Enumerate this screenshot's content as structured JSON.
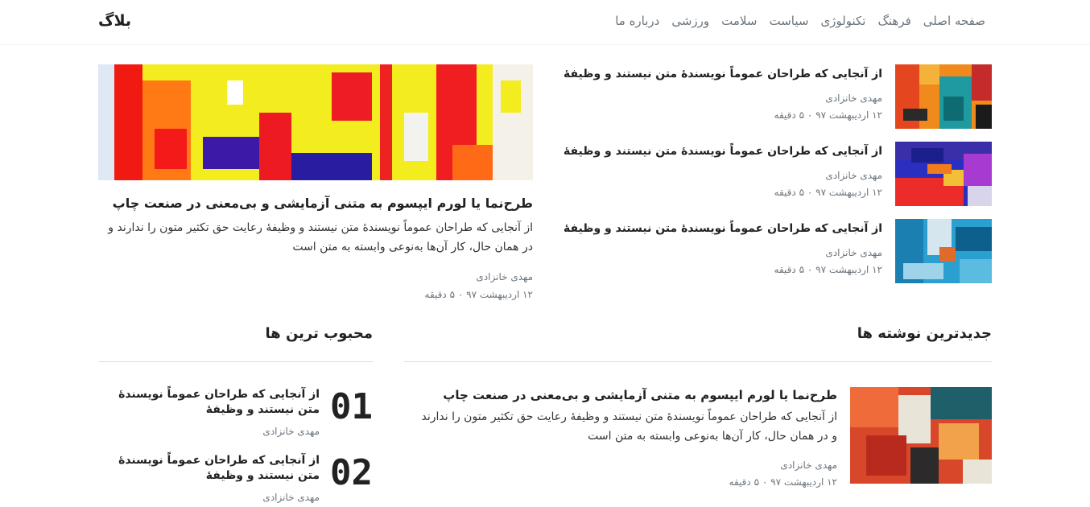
{
  "header": {
    "brand": "بلاگ",
    "nav": [
      "صفحه اصلی",
      "فرهنگ",
      "تکنولوژی",
      "سیاست",
      "سلامت",
      "ورزشی",
      "درباره ما"
    ]
  },
  "featured": {
    "title": "طرح‌نما یا لورم ایپسوم به متنی آزمایشی و بی‌معنی در صنعت چاپ",
    "excerpt": "از آنجایی که طراحان عموماً نویسندهٔ متن نیستند و وظیفهٔ رعایت حق تکثیر متون را ندارند و در همان حال، کار آن‌ها به‌نوعی وابسته به متن است",
    "author": "مهدی خانزادی",
    "meta": "۱۲ اردیبهشت ۹۷ ۰ ۵ دقیقه"
  },
  "side_posts": [
    {
      "title": "از آنجایی که طراحان عموماً نویسندهٔ متن نیستند و وظیفهٔ",
      "author": "مهدی خانزادی",
      "meta": "۱۲ اردیبهشت ۹۷ ۰ ۵ دقیقه"
    },
    {
      "title": "از آنجایی که طراحان عموماً نویسندهٔ متن نیستند و وظیفهٔ",
      "author": "مهدی خانزادی",
      "meta": "۱۲ اردیبهشت ۹۷ ۰ ۵ دقیقه"
    },
    {
      "title": "از آنجایی که طراحان عموماً نویسندهٔ متن نیستند و وظیفهٔ",
      "author": "مهدی خانزادی",
      "meta": "۱۲ اردیبهشت ۹۷ ۰ ۵ دقیقه"
    }
  ],
  "latest": {
    "heading": "جدیدترین نوشته ها",
    "post": {
      "title": "طرح‌نما یا لورم ایپسوم به متنی آزمایشی و بی‌معنی در صنعت چاپ",
      "excerpt": "از آنجایی که طراحان عموماً نویسندهٔ متن نیستند و وظیفهٔ رعایت حق تکثیر متون را ندارند و در همان حال، کار آن‌ها به‌نوعی وابسته به متن است",
      "author": "مهدی خانزادی",
      "meta": "۱۲ اردیبهشت ۹۷ ۰ ۵ دقیقه"
    }
  },
  "popular": {
    "heading": "محبوب ترین ها",
    "items": [
      {
        "number": "01",
        "title": "از آنجایی که طراحان عموماً نویسندهٔ متن نیستند و وظیفهٔ",
        "author": "مهدی خانزادی"
      },
      {
        "number": "02",
        "title": "از آنجایی که طراحان عموماً نویسندهٔ متن نیستند و وظیفهٔ",
        "author": "مهدی خانزادی"
      }
    ]
  }
}
